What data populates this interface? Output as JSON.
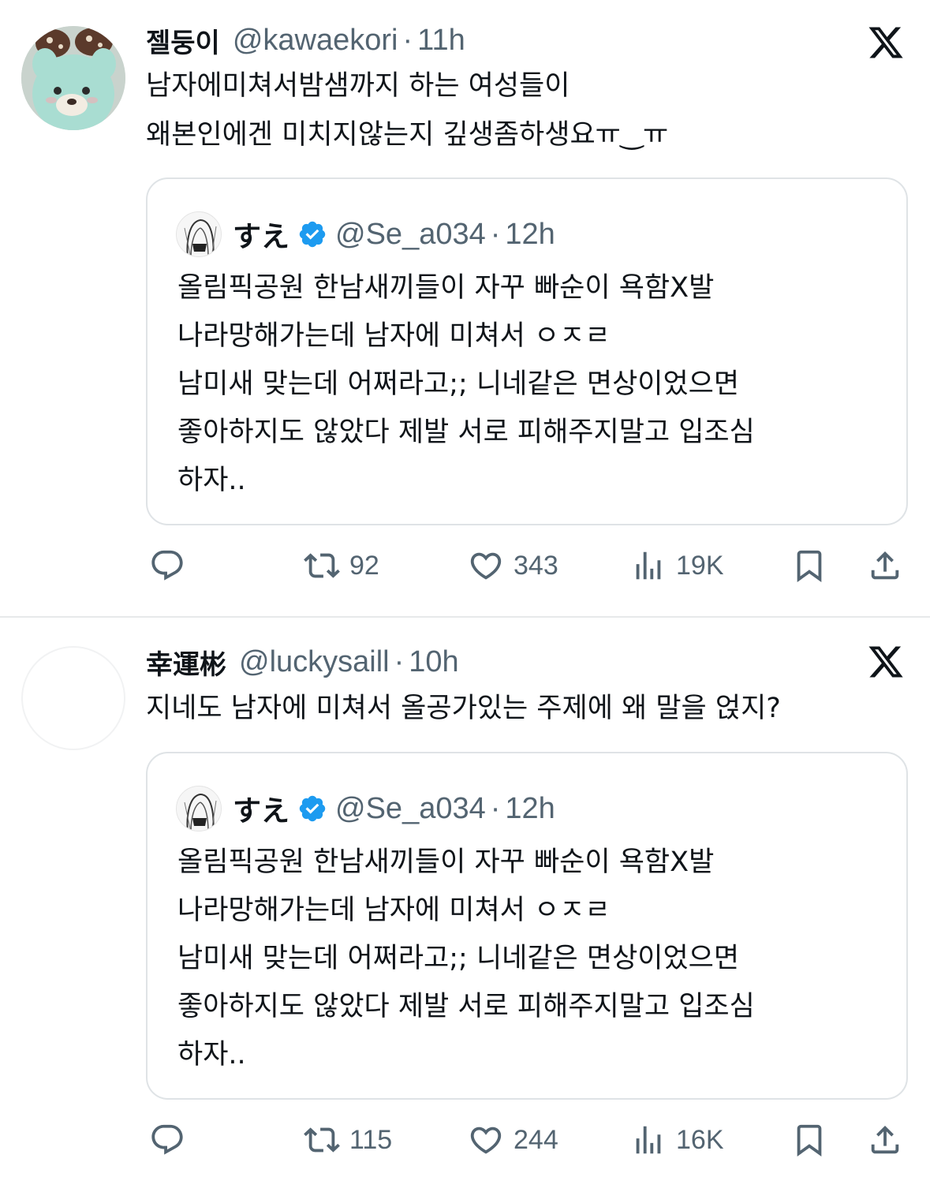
{
  "tweets": [
    {
      "author": {
        "name": "젤둥이",
        "handle": "@kawaekori",
        "time": "11h"
      },
      "text": "남자에미쳐서밤샘까지 하는 여성들이\n왜본인에겐 미치지않는지 깊생좀하생요ㅠ‿ㅠ",
      "quote": {
        "author": {
          "name": "すえ",
          "handle": "@Se_a034",
          "time": "12h",
          "verified": true
        },
        "text": "올림픽공원 한남새끼들이 자꾸 빠순이 욕함X발\n나라망해가는데 남자에 미쳐서 ㅇㅈㄹ\n남미새 맞는데 어쩌라고;; 니네같은 면상이었으면\n좋아하지도 않았다 제발 서로 피해주지말고 입조심\n하자.."
      },
      "stats": {
        "retweets": "92",
        "likes": "343",
        "views": "19K"
      }
    },
    {
      "author": {
        "name": "幸運彬",
        "handle": "@luckysaill",
        "time": "10h"
      },
      "text": "지네도 남자에 미쳐서 올공가있는 주제에 왜 말을 얹지?",
      "quote": {
        "author": {
          "name": "すえ",
          "handle": "@Se_a034",
          "time": "12h",
          "verified": true
        },
        "text": "올림픽공원 한남새끼들이 자꾸 빠순이 욕함X발\n나라망해가는데 남자에 미쳐서 ㅇㅈㄹ\n남미새 맞는데 어쩌라고;; 니네같은 면상이었으면\n좋아하지도 않았다 제발 서로 피해주지말고 입조심\n하자.."
      },
      "stats": {
        "retweets": "115",
        "likes": "244",
        "views": "16K"
      }
    }
  ],
  "ui": {
    "separator": "·",
    "icons": [
      "x-logo-icon",
      "verified-badge-icon",
      "reply-icon",
      "retweet-icon",
      "like-icon",
      "views-icon",
      "bookmark-icon",
      "share-icon"
    ],
    "colors": {
      "text": "#0f1419",
      "secondary": "#536471",
      "verified": "#1d9bf0",
      "border": "#e7e9ea"
    }
  }
}
